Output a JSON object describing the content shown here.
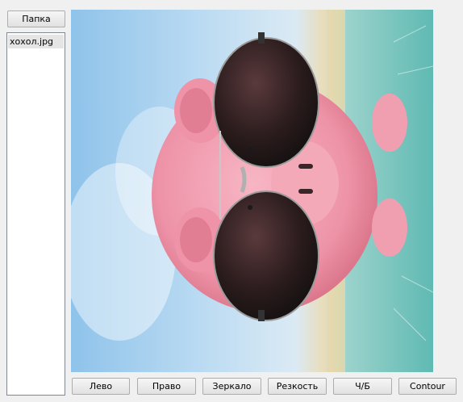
{
  "sidebar": {
    "folder_button": "Папка",
    "files": [
      {
        "name": "хохол.jpg",
        "selected": true
      }
    ]
  },
  "image": {
    "description_icon": "photo-icon",
    "subject": "pink piggy bank wearing aviator sunglasses on a beach (rotated 90°)"
  },
  "toolbar": {
    "left_label": "Лево",
    "right_label": "Право",
    "mirror_label": "Зеркало",
    "sharpness_label": "Резкость",
    "bw_label": "Ч/Б",
    "contour_label": "Contour"
  },
  "colors": {
    "window_bg": "#f0f0f0",
    "list_bg": "#ffffff",
    "selected_item_bg": "#e5e5e5",
    "button_border": "#adadad"
  }
}
